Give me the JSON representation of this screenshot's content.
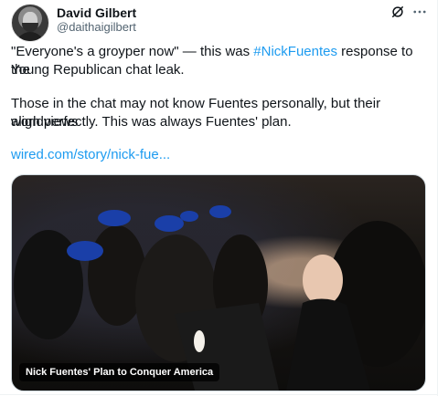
{
  "author": {
    "name": "David Gilbert",
    "handle": "@daithaigilbert"
  },
  "tweet": {
    "line1_pre": "\"Everyone's a groyper now\" — this was ",
    "hashtag": "#NickFuentes",
    "line1_post": " response to the",
    "line2": "Young Republican chat leak.",
    "para2_line1": "Those in the chat may not know Fuentes personally, but their worldviews",
    "para2_line2": "align perfectly. This was always Fuentes' plan.",
    "link": "wired.com/story/nick-fue..."
  },
  "media": {
    "caption": "Nick Fuentes' Plan to Conquer America"
  },
  "icons": {
    "grok": "grok-icon",
    "more": "more-options-icon"
  },
  "colors": {
    "link": "#1d9bf0",
    "text": "#0f1419",
    "secondary": "#536471"
  }
}
